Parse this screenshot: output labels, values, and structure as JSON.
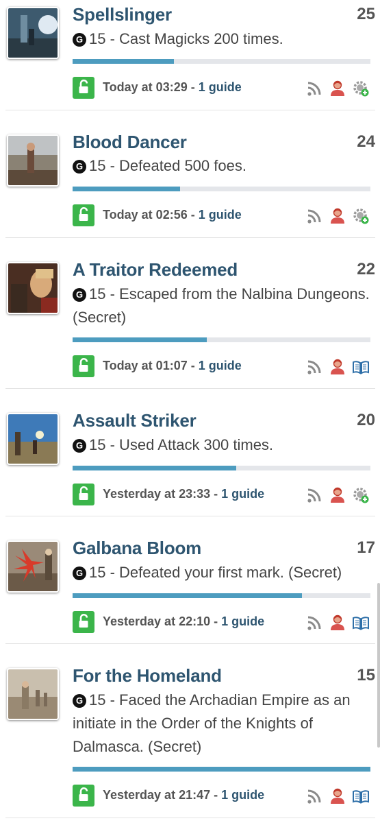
{
  "achievements": [
    {
      "title": "Spellslinger",
      "score": "25",
      "gamerscore": "15",
      "description": "Cast Magicks 200 times.",
      "progress": 0.34,
      "date": "Today at 03:29",
      "guides": "1 guide",
      "extra_icon": "settings-icon",
      "thumb": "magic"
    },
    {
      "title": "Blood Dancer",
      "score": "24",
      "gamerscore": "15",
      "description": "Defeated 500 foes.",
      "progress": 0.36,
      "date": "Today at 02:56",
      "guides": "1 guide",
      "extra_icon": "settings-icon",
      "thumb": "dancer"
    },
    {
      "title": "A Traitor Redeemed",
      "score": "22",
      "gamerscore": "15",
      "description": "Escaped from the Nalbina Dungeons. (Secret)",
      "progress": 0.45,
      "date": "Today at 01:07",
      "guides": "1 guide",
      "extra_icon": "book-icon",
      "thumb": "traitor"
    },
    {
      "title": "Assault Striker",
      "score": "20",
      "gamerscore": "15",
      "description": "Used Attack 300 times.",
      "progress": 0.55,
      "date": "Yesterday at 23:33",
      "guides": "1 guide",
      "extra_icon": "settings-icon",
      "thumb": "striker"
    },
    {
      "title": "Galbana Bloom",
      "score": "17",
      "gamerscore": "15",
      "description": "Defeated your first mark. (Secret)",
      "progress": 0.77,
      "date": "Yesterday at 22:10",
      "guides": "1 guide",
      "extra_icon": "book-icon",
      "thumb": "bloom"
    },
    {
      "title": "For the Homeland",
      "score": "15",
      "gamerscore": "15",
      "description": "Faced the Archadian Empire as an initiate in the Order of the Knights of Dalmasca. (Secret)",
      "progress": 1.0,
      "date": "Yesterday at 21:47",
      "guides": "1 guide",
      "extra_icon": "book-icon",
      "thumb": "homeland"
    }
  ],
  "separator": " - ",
  "icon_names": {
    "unlock": "unlock-icon",
    "rss": "rss-icon",
    "user": "user-icon"
  },
  "colors": {
    "title": "#2e5570",
    "progress_fill": "#4d9cbf",
    "progress_track": "#e4e6ea",
    "unlock_bg": "#3bb54a"
  }
}
